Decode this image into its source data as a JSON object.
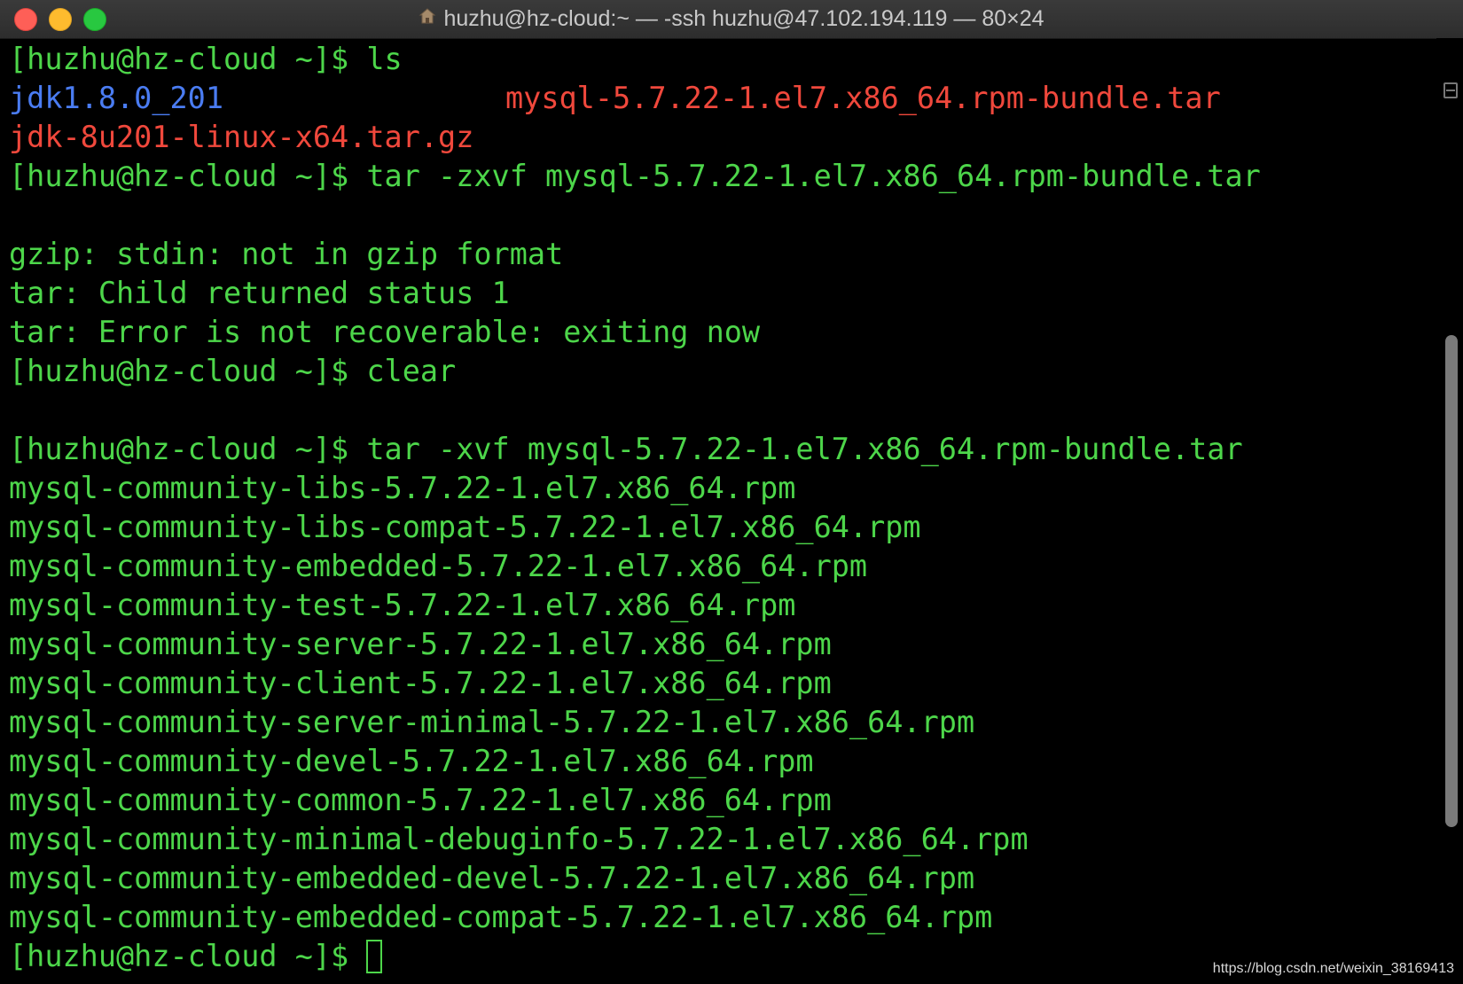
{
  "window": {
    "title": "huzhu@hz-cloud:~ — -ssh huzhu@47.102.194.119 — 80×24"
  },
  "terminal": {
    "lines": [
      {
        "type": "prompt",
        "prompt": "[huzhu@hz-cloud ~]$ ",
        "command": "ls"
      },
      {
        "type": "ls",
        "left": "jdk1.8.0_201",
        "right": "mysql-5.7.22-1.el7.x86_64.rpm-bundle.tar"
      },
      {
        "type": "red",
        "text": "jdk-8u201-linux-x64.tar.gz"
      },
      {
        "type": "prompt",
        "prompt": "[huzhu@hz-cloud ~]$ ",
        "command": "tar -zxvf mysql-5.7.22-1.el7.x86_64.rpm-bundle.tar"
      },
      {
        "type": "blank",
        "text": ""
      },
      {
        "type": "out",
        "text": "gzip: stdin: not in gzip format"
      },
      {
        "type": "out",
        "text": "tar: Child returned status 1"
      },
      {
        "type": "out",
        "text": "tar: Error is not recoverable: exiting now"
      },
      {
        "type": "prompt",
        "prompt": "[huzhu@hz-cloud ~]$ ",
        "command": "clear"
      },
      {
        "type": "blank",
        "text": ""
      },
      {
        "type": "prompt",
        "prompt": "[huzhu@hz-cloud ~]$ ",
        "command": "tar -xvf mysql-5.7.22-1.el7.x86_64.rpm-bundle.tar"
      },
      {
        "type": "out",
        "text": "mysql-community-libs-5.7.22-1.el7.x86_64.rpm"
      },
      {
        "type": "out",
        "text": "mysql-community-libs-compat-5.7.22-1.el7.x86_64.rpm"
      },
      {
        "type": "out",
        "text": "mysql-community-embedded-5.7.22-1.el7.x86_64.rpm"
      },
      {
        "type": "out",
        "text": "mysql-community-test-5.7.22-1.el7.x86_64.rpm"
      },
      {
        "type": "out",
        "text": "mysql-community-server-5.7.22-1.el7.x86_64.rpm"
      },
      {
        "type": "out",
        "text": "mysql-community-client-5.7.22-1.el7.x86_64.rpm"
      },
      {
        "type": "out",
        "text": "mysql-community-server-minimal-5.7.22-1.el7.x86_64.rpm"
      },
      {
        "type": "out",
        "text": "mysql-community-devel-5.7.22-1.el7.x86_64.rpm"
      },
      {
        "type": "out",
        "text": "mysql-community-common-5.7.22-1.el7.x86_64.rpm"
      },
      {
        "type": "out",
        "text": "mysql-community-minimal-debuginfo-5.7.22-1.el7.x86_64.rpm"
      },
      {
        "type": "out",
        "text": "mysql-community-embedded-devel-5.7.22-1.el7.x86_64.rpm"
      },
      {
        "type": "out",
        "text": "mysql-community-embedded-compat-5.7.22-1.el7.x86_64.rpm"
      },
      {
        "type": "current",
        "prompt": "[huzhu@hz-cloud ~]$ ",
        "command": ""
      }
    ]
  },
  "watermark": "https://blog.csdn.net/weixin_38169413",
  "colors": {
    "text": "#4dd64a",
    "directory": "#4a7cf2",
    "archive": "#f0483c",
    "background": "#000000"
  }
}
